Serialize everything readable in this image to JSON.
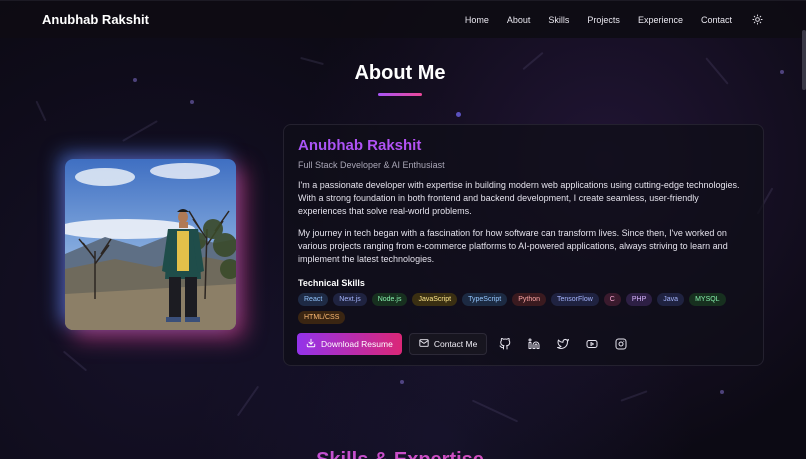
{
  "navbar": {
    "brand": "Anubhab Rakshit",
    "links": [
      "Home",
      "About",
      "Skills",
      "Projects",
      "Experience",
      "Contact"
    ],
    "theme_toggle_icon": "sun-icon"
  },
  "about": {
    "title": "About Me",
    "photo_alt": "portrait-photo",
    "name": "Anubhab Rakshit",
    "subtitle": "Full Stack Developer & AI Enthusiast",
    "paragraphs": [
      "I'm a passionate developer with expertise in building modern web applications using cutting-edge technologies. With a strong foundation in both frontend and backend development, I create seamless, user-friendly experiences that solve real-world problems.",
      "My journey in tech began with a fascination for how software can transform lives. Since then, I've worked on various projects ranging from e-commerce platforms to AI-powered applications, always striving to learn and implement the latest technologies."
    ],
    "skills_heading": "Technical Skills",
    "skills": [
      {
        "label": "React",
        "color": "#93c5fd",
        "bg": "#1e2a44"
      },
      {
        "label": "Next.js",
        "color": "#a5b4fc",
        "bg": "#1f2340"
      },
      {
        "label": "Node.js",
        "color": "#86efac",
        "bg": "#17301f"
      },
      {
        "label": "JavaScript",
        "color": "#fde68a",
        "bg": "#3a2f12"
      },
      {
        "label": "TypeScript",
        "color": "#93c5fd",
        "bg": "#1c2a42"
      },
      {
        "label": "Python",
        "color": "#fca5a5",
        "bg": "#3a1a1f"
      },
      {
        "label": "TensorFlow",
        "color": "#a5b4fc",
        "bg": "#1f2240"
      },
      {
        "label": "C",
        "color": "#f9a8d4",
        "bg": "#3a1a2d"
      },
      {
        "label": "PHP",
        "color": "#d8b4fe",
        "bg": "#2d1f44"
      },
      {
        "label": "Java",
        "color": "#a5b4fc",
        "bg": "#1f2240"
      },
      {
        "label": "MYSQL",
        "color": "#86efac",
        "bg": "#17301f"
      },
      {
        "label": "HTML/CSS",
        "color": "#fdba74",
        "bg": "#3a2512"
      }
    ],
    "download_resume": "Download Resume",
    "contact_me": "Contact Me",
    "socials": [
      "github-icon",
      "linkedin-icon",
      "twitter-icon",
      "youtube-icon",
      "instagram-icon"
    ]
  },
  "next_section": {
    "title": "Skills & Expertise"
  }
}
